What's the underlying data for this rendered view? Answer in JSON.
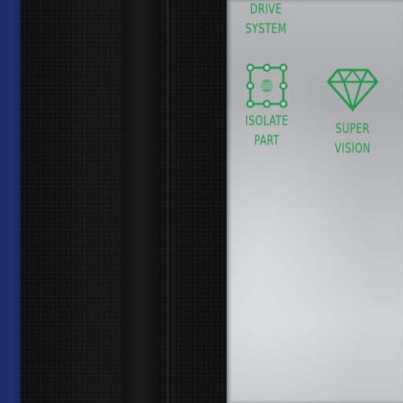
{
  "labels": {
    "drive_system": {
      "line1": "DRIVE",
      "line2": "SYSTEM"
    },
    "isolate_part": {
      "line1": "ISOLATE",
      "line2": "PART"
    },
    "super_vision": {
      "line1": "SUPER",
      "line2": "VISION"
    }
  },
  "icons": {
    "isolate_part": "isolate-part-icon",
    "super_vision": "diamond-gem-icon"
  },
  "colors": {
    "label_green": "#1f9a4a",
    "accent_blue": "#23306f"
  }
}
